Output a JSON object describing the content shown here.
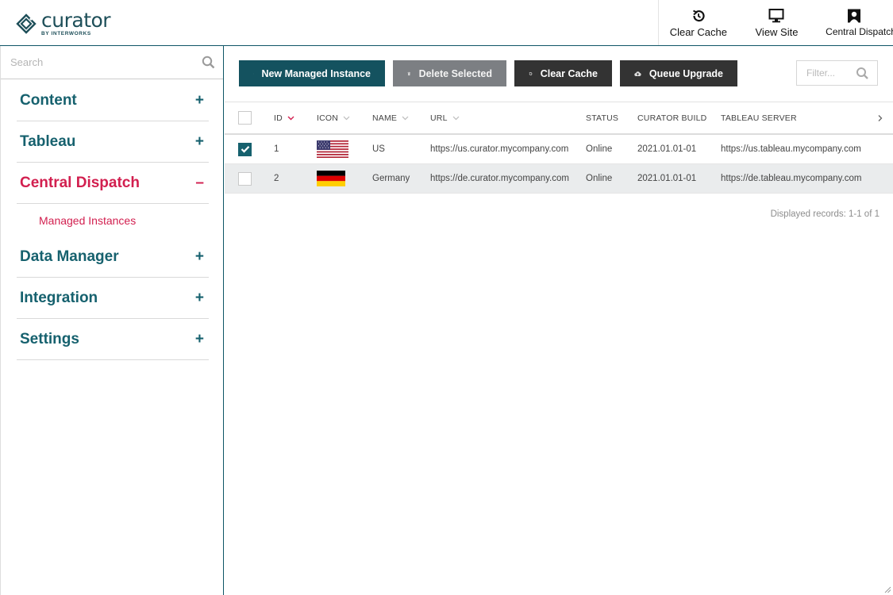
{
  "brand": {
    "name": "curator",
    "tagline": "BY INTERWORKS",
    "color": "#1e4f59"
  },
  "header": {
    "actions": [
      {
        "label": "Clear Cache",
        "icon": "history-icon"
      },
      {
        "label": "View Site",
        "icon": "monitor-icon"
      },
      {
        "label": "Central Dispatch",
        "icon": "user-icon"
      }
    ]
  },
  "sidebar": {
    "search_placeholder": "Search",
    "items": [
      {
        "label": "Content",
        "toggle": "+"
      },
      {
        "label": "Tableau",
        "toggle": "+"
      },
      {
        "label": "Central Dispatch",
        "toggle": "–",
        "active": true,
        "children": [
          {
            "label": "Managed Instances"
          }
        ]
      },
      {
        "label": "Data Manager",
        "toggle": "+"
      },
      {
        "label": "Integration",
        "toggle": "+"
      },
      {
        "label": "Settings",
        "toggle": "+"
      }
    ]
  },
  "toolbar": {
    "new_label": "New Managed Instance",
    "delete_label": "Delete Selected",
    "clear_label": "Clear Cache",
    "queue_label": "Queue Upgrade",
    "filter_placeholder": "Filter..."
  },
  "table": {
    "columns": {
      "id": "ID",
      "icon": "ICON",
      "name": "NAME",
      "url": "URL",
      "status": "STATUS",
      "build": "CURATOR BUILD",
      "server": "TABLEAU SERVER"
    },
    "rows": [
      {
        "checked": true,
        "id": "1",
        "flag": "us-flag-icon",
        "name": "US",
        "url": "https://us.curator.mycompany.com",
        "status": "Online",
        "build": "2021.01.01-01",
        "server": "https://us.tableau.mycompany.com"
      },
      {
        "checked": false,
        "id": "2",
        "flag": "germany-flag-icon",
        "name": "Germany",
        "url": "https://de.curator.mycompany.com",
        "status": "Online",
        "build": "2021.01.01-01",
        "server": "https://de.tableau.mycompany.com"
      }
    ],
    "records_text": "Displayed records: 1-1 of 1"
  },
  "colors": {
    "teal": "#16616e",
    "active": "#d21f4f",
    "dark_button": "#333333",
    "grey_button": "#7c7f83",
    "primary_button": "#14525f"
  }
}
